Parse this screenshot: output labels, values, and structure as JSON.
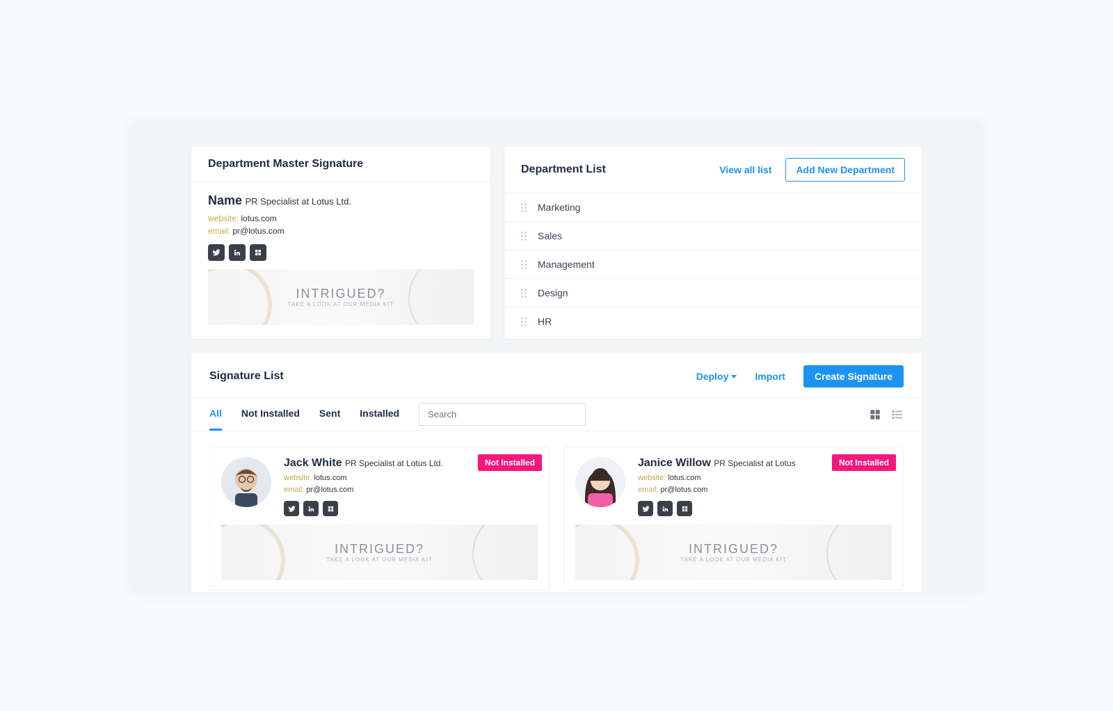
{
  "master": {
    "title": "Department Master Signature",
    "name": "Name",
    "role": "PR Specialist at Lotus Ltd.",
    "website_label": "website:",
    "website_value": "lotus.com",
    "email_label": "email:",
    "email_value": "pr@lotus.com",
    "banner_title": "INTRIGUED?",
    "banner_sub": "TAKE A LOOK AT OUR MEDIA KIT"
  },
  "departments": {
    "title": "Department List",
    "view_all": "View all list",
    "add_new": "Add New Department",
    "items": [
      "Marketing",
      "Sales",
      "Management",
      "Design",
      "HR"
    ]
  },
  "siglist": {
    "title": "Signature List",
    "deploy": "Deploy",
    "import": "Import",
    "create": "Create Signature",
    "tabs": [
      "All",
      "Not Installed",
      "Sent",
      "Installed"
    ],
    "search_placeholder": "Search",
    "cards": [
      {
        "name": "Jack White",
        "role": "PR Specialist at Lotus Ltd.",
        "website_label": "website:",
        "website_value": "lotus.com",
        "email_label": "email:",
        "email_value": "pr@lotus.com",
        "badge": "Not Installed",
        "banner_title": "INTRIGUED?",
        "banner_sub": "TAKE A LOOK AT OUR MEDIA KIT"
      },
      {
        "name": "Janice Willow",
        "role": "PR Specialist at Lotus",
        "website_label": "website:",
        "website_value": "lotus.com",
        "email_label": "email:",
        "email_value": "pr@lotus.com",
        "badge": "Not Installed",
        "banner_title": "INTRIGUED?",
        "banner_sub": "TAKE A LOOK AT OUR MEDIA KIT"
      }
    ]
  }
}
